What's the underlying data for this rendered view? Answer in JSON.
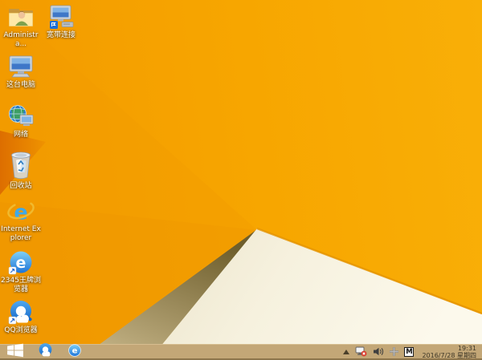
{
  "colors": {
    "wallpaper_orange": "#F7A600",
    "wallpaper_deep_orange": "#DD6E00",
    "wallpaper_cream": "#F8F3E1",
    "wallpaper_shadow_olive": "#8C7B42",
    "taskbar_tan": "#C3A777",
    "icon_label_text": "#FFFFFF",
    "tray_alert_red": "#D83B2B",
    "clock_text": "#3E3727"
  },
  "desktop": {
    "icons": [
      {
        "name": "administrator-folder",
        "label": "Administra..."
      },
      {
        "name": "broadband-connection",
        "label": "宽带连接"
      },
      {
        "name": "this-pc",
        "label": "这台电脑"
      },
      {
        "name": "network",
        "label": "网络"
      },
      {
        "name": "recycle-bin",
        "label": "回收站"
      },
      {
        "name": "internet-explorer",
        "label": "Internet Explorer"
      },
      {
        "name": "2345-browser",
        "label": "2345王牌浏览器"
      },
      {
        "name": "qq-browser",
        "label": "QQ浏览器"
      }
    ]
  },
  "taskbar": {
    "tray": {
      "ime_letter": "M"
    },
    "clock": {
      "time": "19:31",
      "date": "2016/7/28 星期四"
    }
  }
}
